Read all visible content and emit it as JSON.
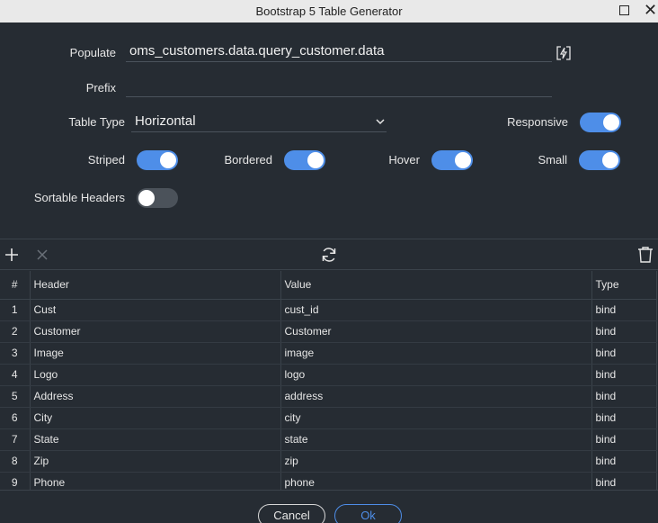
{
  "window": {
    "title": "Bootstrap 5 Table Generator"
  },
  "form": {
    "populate_label": "Populate",
    "populate_value": "oms_customers.data.query_customer.data",
    "prefix_label": "Prefix",
    "prefix_value": "",
    "table_type_label": "Table Type",
    "table_type_value": "Horizontal",
    "responsive_label": "Responsive",
    "responsive_on": true,
    "striped_label": "Striped",
    "striped_on": true,
    "bordered_label": "Bordered",
    "bordered_on": true,
    "hover_label": "Hover",
    "hover_on": true,
    "small_label": "Small",
    "small_on": true,
    "sortable_label": "Sortable Headers",
    "sortable_on": false
  },
  "toolbar": {
    "add_icon": "plus-icon",
    "remove_icon": "close-icon",
    "refresh_icon": "refresh-icon",
    "delete_icon": "trash-icon"
  },
  "grid": {
    "columns": [
      "#",
      "Header",
      "Value",
      "Type"
    ],
    "rows": [
      {
        "num": "1",
        "header": "Cust",
        "value": "cust_id",
        "type": "bind"
      },
      {
        "num": "2",
        "header": "Customer",
        "value": "Customer",
        "type": "bind"
      },
      {
        "num": "3",
        "header": "Image",
        "value": "image",
        "type": "bind"
      },
      {
        "num": "4",
        "header": "Logo",
        "value": "logo",
        "type": "bind"
      },
      {
        "num": "5",
        "header": "Address",
        "value": "address",
        "type": "bind"
      },
      {
        "num": "6",
        "header": "City",
        "value": "city",
        "type": "bind"
      },
      {
        "num": "7",
        "header": "State",
        "value": "state",
        "type": "bind"
      },
      {
        "num": "8",
        "header": "Zip",
        "value": "zip",
        "type": "bind"
      },
      {
        "num": "9",
        "header": "Phone",
        "value": "phone",
        "type": "bind"
      }
    ]
  },
  "footer": {
    "cancel_label": "Cancel",
    "ok_label": "Ok"
  },
  "colors": {
    "accent": "#4e8ee8",
    "background": "#262c33"
  }
}
